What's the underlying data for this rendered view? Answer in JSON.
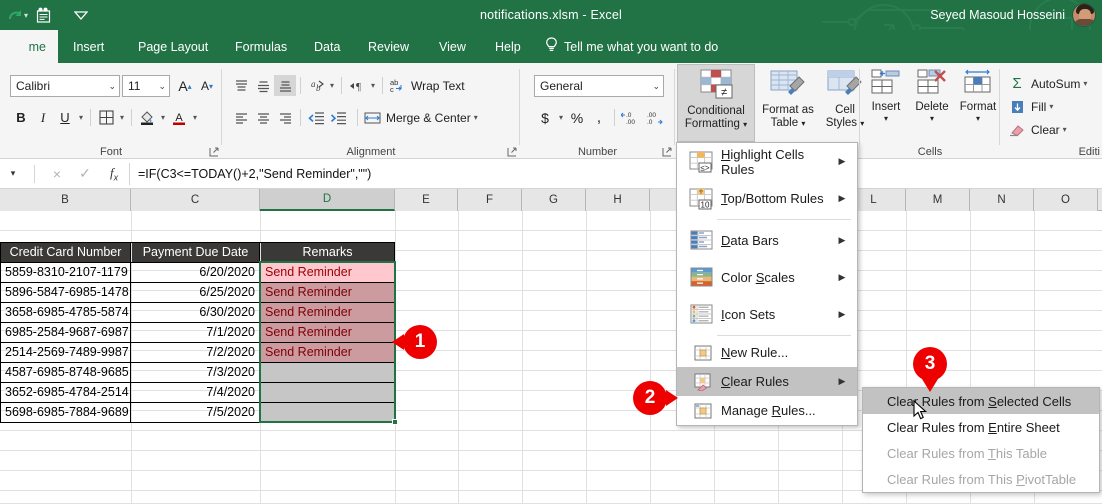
{
  "titlebar": {
    "file_title": "notifications.xlsm  -  Excel",
    "account_name": "Seyed Masoud Hosseini",
    "qat": [
      {
        "name": "redo-icon",
        "label": "Redo"
      },
      {
        "name": "touch-mode-icon",
        "label": "Touch/Mouse Mode"
      },
      {
        "name": "customize-qat-icon",
        "label": "Customize Quick Access Toolbar"
      }
    ]
  },
  "tabs": [
    {
      "label": "me",
      "active": true
    },
    {
      "label": "Insert",
      "active": false
    },
    {
      "label": "Page Layout",
      "active": false
    },
    {
      "label": "Formulas",
      "active": false
    },
    {
      "label": "Data",
      "active": false
    },
    {
      "label": "Review",
      "active": false
    },
    {
      "label": "View",
      "active": false
    },
    {
      "label": "Help",
      "active": false
    }
  ],
  "tellme": {
    "label": "Tell me what you want to do"
  },
  "ribbon": {
    "font_group": {
      "label": "Font",
      "font_name": "Calibri",
      "font_size": "11",
      "grow_font": "A",
      "shrink_font": "A",
      "bold": "B",
      "italic": "I",
      "underline": "U",
      "borders": "Borders",
      "fill_color": "Fill Color",
      "font_color": "A"
    },
    "alignment_group": {
      "label": "Alignment",
      "wrap_text": "Wrap Text",
      "merge_center": "Merge & Center",
      "top_align": "Top Align",
      "middle_align": "Middle Align",
      "bottom_align": "Bottom Align",
      "orientation": "Orientation",
      "align_left": "Align Left",
      "center": "Center",
      "align_right": "Align Right",
      "decrease_indent": "Decrease Indent",
      "increase_indent": "Increase Indent"
    },
    "number_group": {
      "label": "Number",
      "format": "General",
      "accounting": "$",
      "percent": "%",
      "comma": ",",
      "increase_decimal": ".00",
      "decrease_decimal": ".00"
    },
    "styles_group": {
      "conditional_formatting": "Conditional\nFormatting",
      "conditional_formatting_l1": "Conditional",
      "conditional_formatting_l2": "Formatting",
      "format_as_table_l1": "Format as",
      "format_as_table_l2": "Table",
      "cell_styles_l1": "Cell",
      "cell_styles_l2": "Styles"
    },
    "cells_group": {
      "label": "Cells",
      "insert": "Insert",
      "delete": "Delete",
      "format": "Format"
    },
    "editing_group": {
      "label": "Editi",
      "autosum": "AutoSum",
      "fill": "Fill",
      "clear": "Clear"
    }
  },
  "formula_bar": {
    "cancel": "×",
    "enter": "✓",
    "fx": "fx",
    "formula": "=IF(C3<=TODAY()+2,\"Send Reminder\",\"\")"
  },
  "grid": {
    "column_headers": [
      "B",
      "C",
      "D",
      "E",
      "F",
      "G",
      "H",
      "L",
      "M",
      "N",
      "O"
    ],
    "selected_column": "D",
    "table": {
      "headers": [
        "Credit Card Number",
        "Payment Due Date",
        "Remarks"
      ],
      "rows": [
        {
          "card": "5859-8310-2107-1179",
          "due": "6/20/2020",
          "remark": "Send Reminder",
          "state": "active"
        },
        {
          "card": "5896-5847-6985-1478",
          "due": "6/25/2020",
          "remark": "Send Reminder",
          "state": "selected"
        },
        {
          "card": "3658-6985-4785-5874",
          "due": "6/30/2020",
          "remark": "Send Reminder",
          "state": "selected"
        },
        {
          "card": "6985-2584-9687-6987",
          "due": "7/1/2020",
          "remark": "Send Reminder",
          "state": "selected"
        },
        {
          "card": "2514-2569-7489-9987",
          "due": "7/2/2020",
          "remark": "Send Reminder",
          "state": "selected"
        },
        {
          "card": "4587-6985-8748-9685",
          "due": "7/3/2020",
          "remark": "",
          "state": "blank"
        },
        {
          "card": "3652-6985-4784-2514",
          "due": "7/4/2020",
          "remark": "",
          "state": "blank"
        },
        {
          "card": "5698-6985-7884-9689",
          "due": "7/5/2020",
          "remark": "",
          "state": "blank"
        }
      ]
    }
  },
  "cf_menu": {
    "items": [
      {
        "label": "Highlight Cells Rules",
        "accel": "H",
        "icon": "highlight-cells-rules-icon",
        "arrow": true,
        "state": "normal"
      },
      {
        "label": "Top/Bottom Rules",
        "accel": "T",
        "icon": "top-bottom-rules-icon",
        "arrow": true,
        "state": "normal"
      },
      {
        "label": "Data Bars",
        "accel": "D",
        "icon": "data-bars-icon",
        "arrow": true,
        "state": "normal"
      },
      {
        "label": "Color Scales",
        "accel": "S",
        "icon": "color-scales-icon",
        "arrow": true,
        "state": "normal"
      },
      {
        "label": "Icon Sets",
        "accel": "I",
        "icon": "icon-sets-icon",
        "arrow": true,
        "state": "normal"
      },
      {
        "label": "New Rule...",
        "accel": "N",
        "icon": "new-rule-icon",
        "arrow": false,
        "state": "normal"
      },
      {
        "label": "Clear Rules",
        "accel": "C",
        "icon": "clear-rules-icon",
        "arrow": true,
        "state": "highlighted"
      },
      {
        "label": "Manage Rules...",
        "accel": "R",
        "icon": "manage-rules-icon",
        "arrow": false,
        "state": "normal"
      }
    ]
  },
  "clear_rules_submenu": {
    "items": [
      {
        "label": "Clear Rules from Selected Cells",
        "state": "highlighted"
      },
      {
        "label": "Clear Rules from Entire Sheet",
        "state": "normal"
      },
      {
        "label": "Clear Rules from This Table",
        "state": "disabled"
      },
      {
        "label": "Clear Rules from This PivotTable",
        "state": "disabled"
      }
    ]
  },
  "callouts": [
    {
      "number": "1",
      "direction": "left"
    },
    {
      "number": "2",
      "direction": "right"
    },
    {
      "number": "3",
      "direction": "down"
    }
  ],
  "colors": {
    "excel_green": "#217346",
    "badge_red": "#ee0000",
    "cf_pink_fill": "#ffc7ce",
    "cf_pink_text": "#9c0006",
    "table_header": "#3b3838"
  }
}
